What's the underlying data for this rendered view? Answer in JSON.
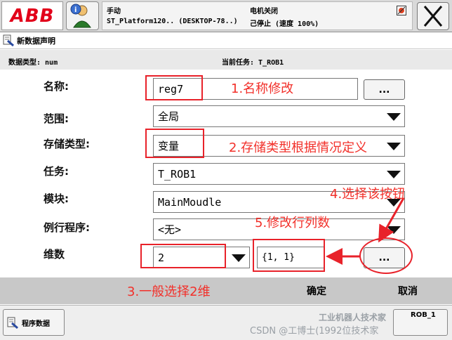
{
  "topbar": {
    "logo_text": "ABB",
    "mode_label": "手动",
    "controller_label": "ST_Platform120.. (DESKTOP-78..)",
    "motor_status": "电机关闭",
    "run_status": "己停止 (速度 100%)"
  },
  "title": {
    "text": "新数据声明"
  },
  "info": {
    "data_type": "数据类型: num",
    "current_task": "当前任务: T_ROB1"
  },
  "form": {
    "name_label": "名称:",
    "name_value": "reg7",
    "name_browse": "...",
    "scope_label": "范围:",
    "scope_value": "全局",
    "storage_label": "存储类型:",
    "storage_value": "变量",
    "task_label": "任务:",
    "task_value": "T_ROB1",
    "module_label": "模块:",
    "module_value": "MainMoudle",
    "routine_label": "例行程序:",
    "routine_value": "<无>",
    "dim_label": "维数",
    "dim_value": "2",
    "dim_size_value": "{1, 1}",
    "dim_browse": "..."
  },
  "annotations": {
    "a1": "1.名称修改",
    "a2": "2.存储类型根据情况定义",
    "a3": "3.一般选择2维",
    "a4": "4.选择该按钮",
    "a5": "5.修改行列数"
  },
  "bottombar": {
    "ok": "确定",
    "cancel": "取消"
  },
  "taskbar": {
    "program_data": "程序数据",
    "rob_label": "ROB_1",
    "watermark1": "工业机器人技术家",
    "watermark2": "CSDN @工博士(1992位技术家"
  },
  "colors": {
    "annotation": "#f2302a",
    "logo": "#e2001a"
  }
}
